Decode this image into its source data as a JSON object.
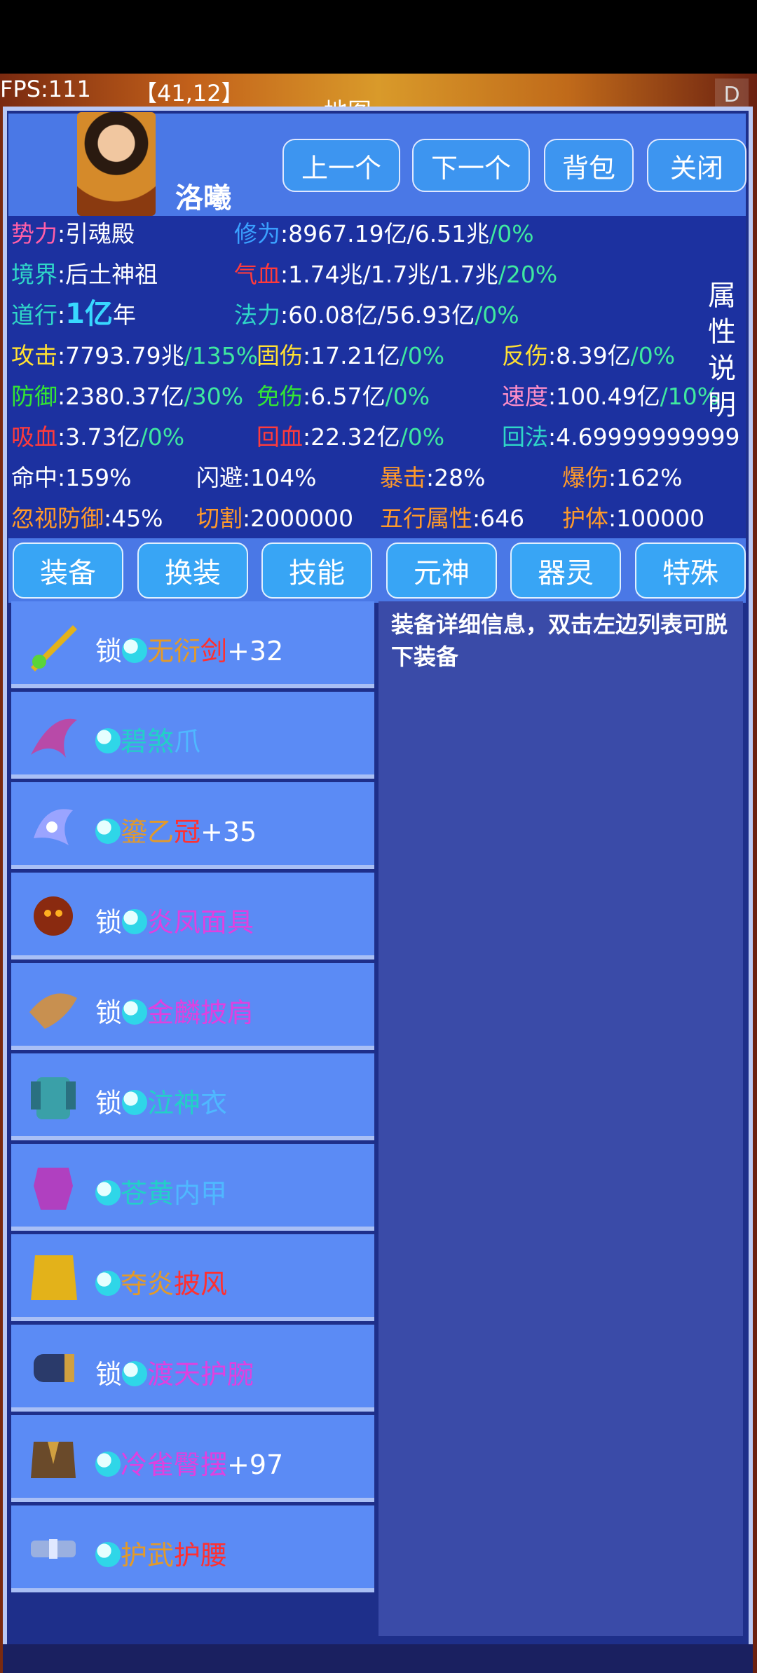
{
  "hud": {
    "fps": "FPS:111",
    "coords": "【41,12】",
    "map_label": "地图",
    "corner": "D"
  },
  "character": {
    "name": "洛曦"
  },
  "header_buttons": {
    "prev": "上一个",
    "next": "下一个",
    "bag": "背包",
    "close": "关闭"
  },
  "stats": {
    "faction_label": "势力",
    "faction_value": ":引魂殿",
    "realm_label": "境界",
    "realm_value": ":后土神祖",
    "dao_label": "道行",
    "dao_sep": ":",
    "dao_value": "1亿",
    "dao_unit": "年",
    "cultivation_label": "修为",
    "cultivation_value": ":8967.19亿/6.51兆",
    "cultivation_pct": "/0%",
    "hp_label": "气血",
    "hp_value": ":1.74兆/1.7兆/1.7兆",
    "hp_pct": "/20%",
    "mp_label": "法力",
    "mp_value": ":60.08亿/56.93亿",
    "mp_pct": "/0%",
    "attack_label": "攻击",
    "attack_value": ":7793.79兆",
    "attack_pct": "/135%",
    "fixed_dmg_label": "固伤",
    "fixed_dmg_value": ":17.21亿",
    "fixed_dmg_pct": "/0%",
    "reflect_label": "反伤",
    "reflect_value": ":8.39亿",
    "reflect_pct": "/0%",
    "defense_label": "防御",
    "defense_value": ":2380.37亿",
    "defense_pct": "/30%",
    "immune_label": "免伤",
    "immune_value": ":6.57亿",
    "immune_pct": "/0%",
    "speed_label": "速度",
    "speed_value": ":100.49亿",
    "speed_pct": "/10%",
    "lifesteal_label": "吸血",
    "lifesteal_value": ":3.73亿",
    "lifesteal_pct": "/0%",
    "hp_regen_label": "回血",
    "hp_regen_value": ":22.32亿",
    "hp_regen_pct": "/0%",
    "mp_regen_label": "回法",
    "mp_regen_value": ":4.69999999999",
    "hit": "命中:159%",
    "dodge": "闪避:104%",
    "crit_label": "暴击",
    "crit_value": ":28%",
    "crit_dmg_label": "爆伤",
    "crit_dmg_value": ":162%",
    "ignore_def_label": "忽视防御",
    "ignore_def_value": ":45%",
    "cut_label": "切割",
    "cut_value": ":2000000",
    "element_label": "五行属性",
    "element_value": ":646",
    "shield_label": "护体",
    "shield_value": ":100000",
    "side_label": [
      "属",
      "性",
      "说",
      "明"
    ]
  },
  "tabs": [
    "装备",
    "换装",
    "技能",
    "元神",
    "器灵",
    "特殊"
  ],
  "equipment": [
    {
      "lock": "锁",
      "parts": [
        {
          "t": "无衍",
          "c": "#e39a2a"
        },
        {
          "t": "剑",
          "c": "#ff3030"
        }
      ],
      "plus": "+32"
    },
    {
      "lock": "",
      "parts": [
        {
          "t": "碧煞",
          "c": "#22d0c8"
        },
        {
          "t": "爪",
          "c": "#4fb8ff"
        }
      ],
      "plus": ""
    },
    {
      "lock": "",
      "parts": [
        {
          "t": "鎏乙",
          "c": "#e39a2a"
        },
        {
          "t": "冠",
          "c": "#ff3030"
        }
      ],
      "plus": "+35"
    },
    {
      "lock": "锁",
      "parts": [
        {
          "t": "炎凤面具",
          "c": "#e040e0"
        }
      ],
      "plus": ""
    },
    {
      "lock": "锁",
      "parts": [
        {
          "t": "金麟披肩",
          "c": "#e040e0"
        }
      ],
      "plus": ""
    },
    {
      "lock": "锁",
      "parts": [
        {
          "t": "泣神",
          "c": "#22d0c8"
        },
        {
          "t": "衣",
          "c": "#4fb8ff"
        }
      ],
      "plus": ""
    },
    {
      "lock": "",
      "parts": [
        {
          "t": "苍黄",
          "c": "#22d0c8"
        },
        {
          "t": "内甲",
          "c": "#4fb8ff"
        }
      ],
      "plus": ""
    },
    {
      "lock": "",
      "parts": [
        {
          "t": "夺炎",
          "c": "#e39a2a"
        },
        {
          "t": "披风",
          "c": "#ff3030"
        }
      ],
      "plus": ""
    },
    {
      "lock": "锁",
      "parts": [
        {
          "t": "渡天护腕",
          "c": "#e040e0"
        }
      ],
      "plus": ""
    },
    {
      "lock": "",
      "parts": [
        {
          "t": "冷雀臀摆",
          "c": "#e040e0"
        }
      ],
      "plus": "+97"
    },
    {
      "lock": "",
      "parts": [
        {
          "t": "护武",
          "c": "#e39a2a"
        },
        {
          "t": "护腰",
          "c": "#ff3030"
        }
      ],
      "plus": ""
    }
  ],
  "detail": {
    "text": "装备详细信息，双击左边列表可脱下装备"
  },
  "colors": {
    "label_pink": "#ff5fa8",
    "label_teal": "#2fd6c8",
    "label_blue": "#3aa0ff",
    "label_red": "#ff3b3b",
    "label_yellow": "#ffe033",
    "label_green": "#33e633",
    "label_orange": "#ff9a2a",
    "percent_green": "#3fe8a0"
  }
}
